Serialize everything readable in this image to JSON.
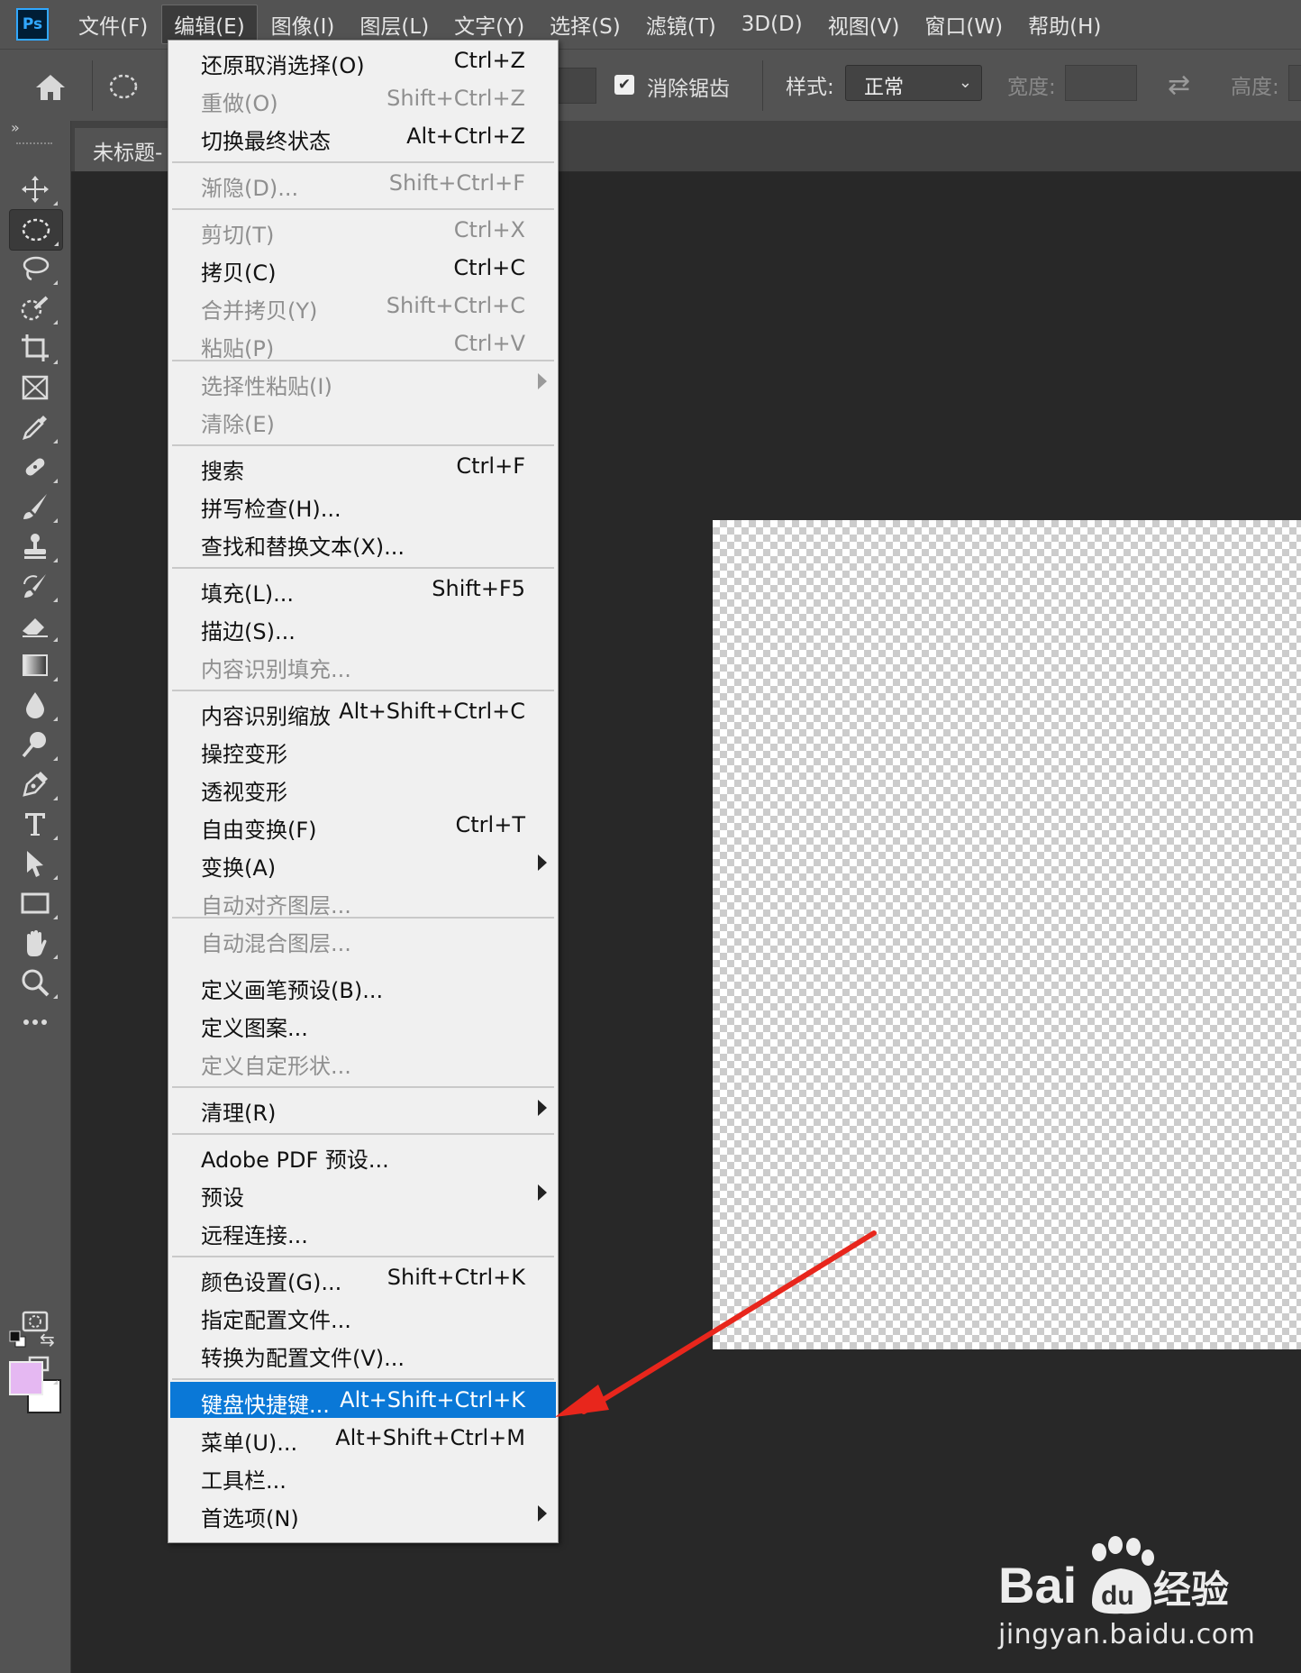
{
  "app": {
    "logo_text": "Ps"
  },
  "menubar": {
    "items": [
      "文件(F)",
      "编辑(E)",
      "图像(I)",
      "图层(L)",
      "文字(Y)",
      "选择(S)",
      "滤镜(T)",
      "3D(D)",
      "视图(V)",
      "窗口(W)",
      "帮助(H)"
    ],
    "active_index": 1
  },
  "options": {
    "antialias_label": "消除锯齿",
    "antialias_checked": true,
    "style_label": "样式:",
    "style_value": "正常",
    "width_label": "宽度:",
    "height_label": "高度:"
  },
  "document": {
    "tab_title": "未标题-"
  },
  "colors": {
    "foreground": "#e5b8f2",
    "background": "#ffffff",
    "highlight": "#0a78d7",
    "arrow": "#e8261c"
  },
  "tools": [
    "move-icon",
    "elliptical-marquee-icon",
    "lasso-icon",
    "quick-selection-icon",
    "crop-icon",
    "frame-icon",
    "eyedropper-icon",
    "healing-brush-icon",
    "brush-icon",
    "clone-stamp-icon",
    "history-brush-icon",
    "eraser-icon",
    "gradient-icon",
    "blur-icon",
    "dodge-icon",
    "pen-icon",
    "type-icon",
    "path-selection-icon",
    "rectangle-icon",
    "hand-icon",
    "zoom-icon",
    "more-tools-icon",
    "quick-mask-icon",
    "screen-mode-icon"
  ],
  "edit_menu": {
    "items": [
      {
        "label": "还原取消选择(O)",
        "shortcut": "Ctrl+Z",
        "disabled": false
      },
      {
        "label": "重做(O)",
        "shortcut": "Shift+Ctrl+Z",
        "disabled": true
      },
      {
        "label": "切换最终状态",
        "shortcut": "Alt+Ctrl+Z",
        "disabled": false
      },
      {
        "label": "渐隐(D)...",
        "shortcut": "Shift+Ctrl+F",
        "disabled": true
      },
      {
        "label": "剪切(T)",
        "shortcut": "Ctrl+X",
        "disabled": true
      },
      {
        "label": "拷贝(C)",
        "shortcut": "Ctrl+C",
        "disabled": false
      },
      {
        "label": "合并拷贝(Y)",
        "shortcut": "Shift+Ctrl+C",
        "disabled": true
      },
      {
        "label": "粘贴(P)",
        "shortcut": "Ctrl+V",
        "disabled": true
      },
      {
        "label": "选择性粘贴(I)",
        "shortcut": "",
        "disabled": true,
        "submenu": true
      },
      {
        "label": "清除(E)",
        "shortcut": "",
        "disabled": true
      },
      {
        "label": "搜索",
        "shortcut": "Ctrl+F",
        "disabled": false
      },
      {
        "label": "拼写检查(H)...",
        "shortcut": "",
        "disabled": false
      },
      {
        "label": "查找和替换文本(X)...",
        "shortcut": "",
        "disabled": false
      },
      {
        "label": "填充(L)...",
        "shortcut": "Shift+F5",
        "disabled": false
      },
      {
        "label": "描边(S)...",
        "shortcut": "",
        "disabled": false
      },
      {
        "label": "内容识别填充...",
        "shortcut": "",
        "disabled": true
      },
      {
        "label": "内容识别缩放",
        "shortcut": "Alt+Shift+Ctrl+C",
        "disabled": false
      },
      {
        "label": "操控变形",
        "shortcut": "",
        "disabled": false
      },
      {
        "label": "透视变形",
        "shortcut": "",
        "disabled": false
      },
      {
        "label": "自由变换(F)",
        "shortcut": "Ctrl+T",
        "disabled": false
      },
      {
        "label": "变换(A)",
        "shortcut": "",
        "disabled": false,
        "submenu": true
      },
      {
        "label": "自动对齐图层...",
        "shortcut": "",
        "disabled": true
      },
      {
        "label": "自动混合图层...",
        "shortcut": "",
        "disabled": true
      },
      {
        "label": "定义画笔预设(B)...",
        "shortcut": "",
        "disabled": false
      },
      {
        "label": "定义图案...",
        "shortcut": "",
        "disabled": false
      },
      {
        "label": "定义自定形状...",
        "shortcut": "",
        "disabled": true
      },
      {
        "label": "清理(R)",
        "shortcut": "",
        "disabled": false,
        "submenu": true
      },
      {
        "label": "Adobe PDF 预设...",
        "shortcut": "",
        "disabled": false
      },
      {
        "label": "预设",
        "shortcut": "",
        "disabled": false,
        "submenu": true
      },
      {
        "label": "远程连接...",
        "shortcut": "",
        "disabled": false
      },
      {
        "label": "颜色设置(G)...",
        "shortcut": "Shift+Ctrl+K",
        "disabled": false
      },
      {
        "label": "指定配置文件...",
        "shortcut": "",
        "disabled": false
      },
      {
        "label": "转换为配置文件(V)...",
        "shortcut": "",
        "disabled": false
      },
      {
        "label": "键盘快捷键...",
        "shortcut": "Alt+Shift+Ctrl+K",
        "disabled": false,
        "highlighted": true
      },
      {
        "label": "菜单(U)...",
        "shortcut": "Alt+Shift+Ctrl+M",
        "disabled": false
      },
      {
        "label": "工具栏...",
        "shortcut": "",
        "disabled": false
      },
      {
        "label": "首选项(N)",
        "shortcut": "",
        "disabled": false,
        "submenu": true
      }
    ]
  },
  "watermark": {
    "brand_left": "Bai",
    "brand_mid": "du",
    "brand_cn": "经验",
    "url": "jingyan.baidu.com"
  }
}
